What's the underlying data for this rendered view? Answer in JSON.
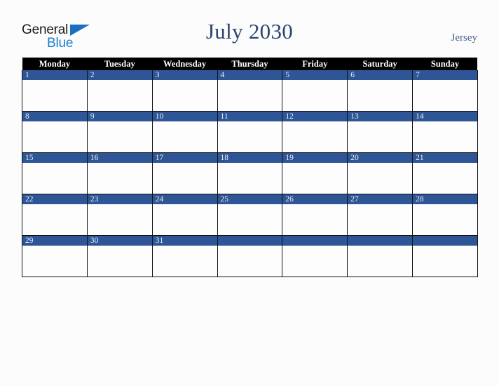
{
  "brand": {
    "name_part1": "General",
    "name_part2": "Blue",
    "triangle_icon": "blue-triangle-icon",
    "colors": {
      "dark_text": "#1a1a1a",
      "blue_text": "#1b7fd0",
      "triangle": "#1b6fc0"
    }
  },
  "header": {
    "title": "July 2030",
    "region": "Jersey",
    "title_color": "#2b4570",
    "region_color": "#46618f"
  },
  "calendar": {
    "month": "July",
    "year": "2030",
    "weekday_headers": [
      "Monday",
      "Tuesday",
      "Wednesday",
      "Thursday",
      "Friday",
      "Saturday",
      "Sunday"
    ],
    "header_background": "#000000",
    "header_text_color": "#ffffff",
    "date_band_color": "#2e5595",
    "date_text_color": "#e9eef7",
    "cell_background": "#fdfdfd",
    "border_color": "#111111",
    "weeks": [
      {
        "days": [
          {
            "date": "1"
          },
          {
            "date": "2"
          },
          {
            "date": "3"
          },
          {
            "date": "4"
          },
          {
            "date": "5"
          },
          {
            "date": "6"
          },
          {
            "date": "7"
          }
        ]
      },
      {
        "days": [
          {
            "date": "8"
          },
          {
            "date": "9"
          },
          {
            "date": "10"
          },
          {
            "date": "11"
          },
          {
            "date": "12"
          },
          {
            "date": "13"
          },
          {
            "date": "14"
          }
        ]
      },
      {
        "days": [
          {
            "date": "15"
          },
          {
            "date": "16"
          },
          {
            "date": "17"
          },
          {
            "date": "18"
          },
          {
            "date": "19"
          },
          {
            "date": "20"
          },
          {
            "date": "21"
          }
        ]
      },
      {
        "days": [
          {
            "date": "22"
          },
          {
            "date": "23"
          },
          {
            "date": "24"
          },
          {
            "date": "25"
          },
          {
            "date": "26"
          },
          {
            "date": "27"
          },
          {
            "date": "28"
          }
        ]
      },
      {
        "days": [
          {
            "date": "29"
          },
          {
            "date": "30"
          },
          {
            "date": "31"
          },
          {
            "date": ""
          },
          {
            "date": ""
          },
          {
            "date": ""
          },
          {
            "date": ""
          }
        ]
      }
    ]
  }
}
